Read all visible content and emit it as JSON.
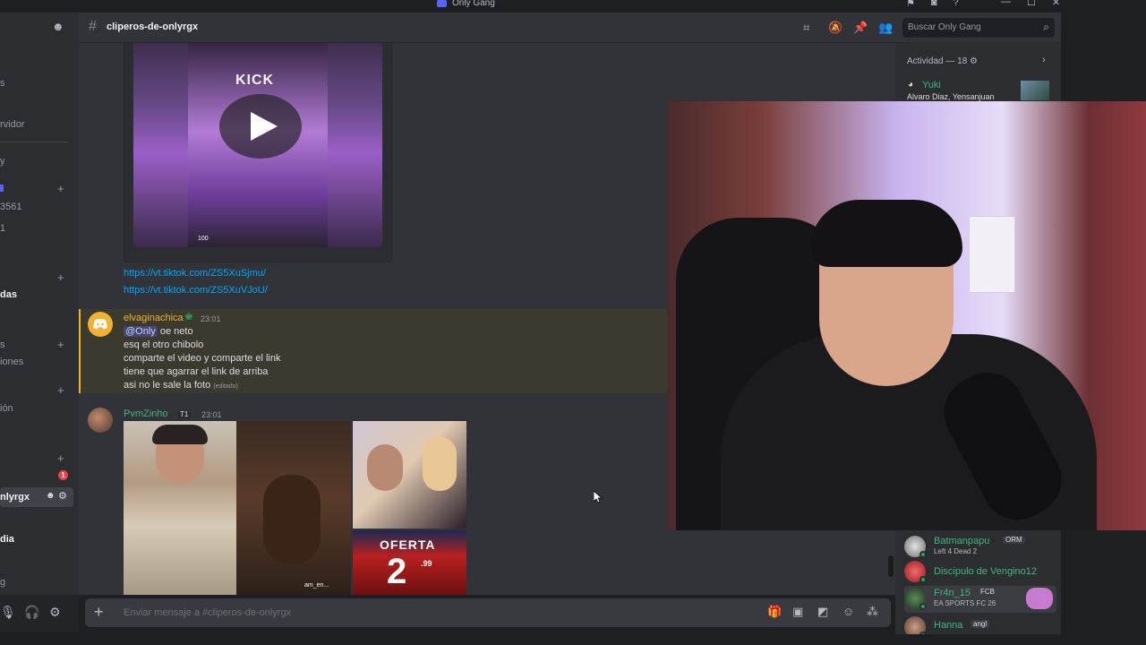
{
  "window": {
    "title": "Only Gang",
    "controls": [
      "—",
      "☐",
      "✕"
    ]
  },
  "sidebar": {
    "fragments": [
      "s",
      "rvidor",
      "y",
      "3561",
      "1",
      "das",
      "s",
      "iones",
      "ión",
      "nlyrgx",
      "dia",
      "g"
    ],
    "badge": "1"
  },
  "header": {
    "channel_name": "cliperos-de-onlyrgx",
    "search_placeholder": "Buscar Only Gang"
  },
  "chat": {
    "video_caption": "KICK",
    "video_counter": "100",
    "links": [
      "https://vt.tiktok.com/ZS5XuSjmu/",
      "https://vt.tiktok.com/ZS5XuVJoU/"
    ],
    "messages": [
      {
        "username": "elvaginachica",
        "time": "23:01",
        "mention": "@Only",
        "lines": [
          "oe neto",
          "esq el otro chibolo",
          "comparte el video y comparte el link",
          "tiene que agarrar el link de arriba",
          "asi no le sale la foto"
        ],
        "edited": "(editado)"
      },
      {
        "username": "PvmZinho",
        "tag": "T1",
        "time": "23:01",
        "image_labels": [
          "OFERTA",
          "2",
          ".99",
          "am_en..."
        ]
      }
    ],
    "input_placeholder": "Enviar mensaje a #cliperos-de-onlyrgx"
  },
  "members": {
    "activity_label": "Actividad — 18",
    "list": [
      {
        "name": "Yuki",
        "status": "Alvaro Diaz, Yensanjuan",
        "tag": ""
      },
      {
        "name": "Batmanpapu",
        "status": "Left 4 Dead 2",
        "tag": "ORM"
      },
      {
        "name": "Discipulo de Vengino12",
        "status": "",
        "tag": ""
      },
      {
        "name": "Fr4n_15",
        "status": "EA SPORTS FC 26",
        "tag": "FCB"
      },
      {
        "name": "Hanna",
        "status": "",
        "tag": "angl"
      }
    ]
  },
  "colors": {
    "accent": "#5865f2",
    "link": "#00a8fc",
    "highlight_border": "#f0b232",
    "online": "#23a55a"
  }
}
